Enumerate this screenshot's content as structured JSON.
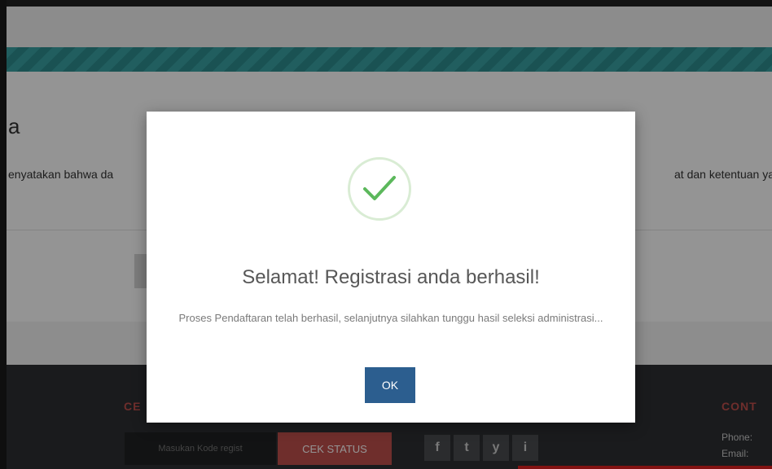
{
  "page": {
    "title": "a",
    "statement_left": "enyatakan bahwa da",
    "statement_right": "at dan ketentuan yan"
  },
  "footer": {
    "left_heading": "CE",
    "right_heading": "CONT",
    "regist_placeholder": "Masukan Kode regist",
    "cek_status_label": "CEK STATUS",
    "social": [
      "f",
      "t",
      "y",
      "i"
    ],
    "social_icons": [
      "facebook-icon",
      "twitter-icon",
      "youtube-icon",
      "instagram-icon"
    ],
    "contact_phone_label": "Phone:",
    "contact_email_label": "Email:"
  },
  "modal": {
    "title": "Selamat! Registrasi anda berhasil!",
    "text": "Proses Pendaftaran telah berhasil, selanjutnya silahkan tunggu hasil seleksi administrasi...",
    "ok_label": "OK",
    "icon": "check-icon"
  },
  "colors": {
    "teal": "#3aa2a4",
    "accent_red": "#c0504d",
    "ok_blue": "#2c5e8f",
    "success_green": "#5cb85c"
  }
}
